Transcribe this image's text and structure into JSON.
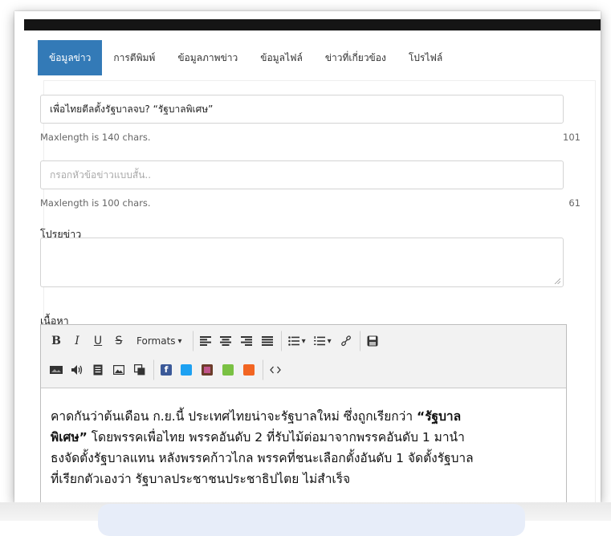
{
  "tabs": [
    {
      "label": "ข้อมูลข่าว",
      "active": true
    },
    {
      "label": "การตีพิมพ์",
      "active": false
    },
    {
      "label": "ข้อมูลภาพข่าว",
      "active": false
    },
    {
      "label": "ข้อมูลไฟล์",
      "active": false
    },
    {
      "label": "ข่าวที่เกี่ยวข้อง",
      "active": false
    },
    {
      "label": "โปรไฟล์",
      "active": false
    }
  ],
  "title_field": {
    "value": "เพื่อไทยตีลตั้งรัฐบาลจบ? “รัฐบาลพิเศษ”",
    "hint": "Maxlength is 140 chars.",
    "count": "101"
  },
  "short_title_field": {
    "placeholder": "กรอกหัวข้อข่าวแบบสั้น..",
    "hint": "Maxlength is 100 chars.",
    "count": "61"
  },
  "intro": {
    "label": "โปรยข่าว",
    "value": ""
  },
  "content": {
    "label": "เนื้อหา",
    "toolbar": {
      "bold": "B",
      "italic": "I",
      "underline": "U",
      "strike": "S",
      "formats": "Formats"
    },
    "line1_a": "คาดกันว่าต้นเดือน ก.ย.นี้ ประเทศไทยน่าจะรัฐบาลใหม่ ซึ่งถูกเรียกว่า ",
    "line1_b": "“รัฐบาล",
    "line2_a": "พิเศษ”",
    "line2_b": " โดยพรรคเพื่อไทย พรรคอันดับ 2 ที่รับไม้ต่อมาจากพรรคอันดับ 1 มานำ",
    "line3": "ธงจัดตั้งรัฐบาลแทน หลังพรรคก้าวไกล พรรคที่ชนะเลือกตั้งอันดับ 1 จัดตั้งรัฐบาล",
    "line4": "ที่เรียกตัวเองว่า รัฐบาลประชาชนประชาธิปไตย ไม่สำเร็จ"
  },
  "colors": {
    "active_tab": "#337ab7",
    "facebook": "#3b5998",
    "twitter": "#1da1f2",
    "instagram": "#c1558b",
    "line": "#7ac143",
    "rss": "#f26522"
  }
}
